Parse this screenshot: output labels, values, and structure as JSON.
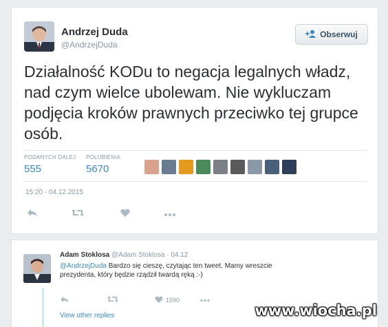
{
  "tweet": {
    "author_name": "Andrzej Duda",
    "author_handle": "@AndrzejDuda",
    "follow_label": "Obserwuj",
    "text": "Działalność KODu to negacja legalnych władz, nad czym wielce ubolewam. Nie wykluczam podjęcia kroków prawnych przeciwko tej grupce osób.",
    "retweets_label": "PODANYCH DALEJ",
    "retweets_value": "555",
    "likes_label": "POLUBIENIA",
    "likes_value": "5670",
    "timestamp": "15:20 - 04.12.2015",
    "liker_colors": [
      "#d9a28c",
      "#6a7c91",
      "#e49a1e",
      "#4c8a5c",
      "#7b7f86",
      "#5a5a5a",
      "#8a98a8",
      "#4a5f7a",
      "#2f3f5a"
    ]
  },
  "reply": {
    "author_name": "Adam Stoklosa",
    "author_handle": "@Adam Stoklosa",
    "date": "· 04.12",
    "mention": "@AndrzejDuda",
    "text_line1": " Bardzo się cieszę, czytając ten tweet. Mamy wreszcie",
    "text_line2": "prezydenta, który będzie rządził twardą ręką :-)",
    "likes_count": "1590",
    "view_other_replies": "View other replies"
  },
  "watermark": "www.wiocha.pl"
}
